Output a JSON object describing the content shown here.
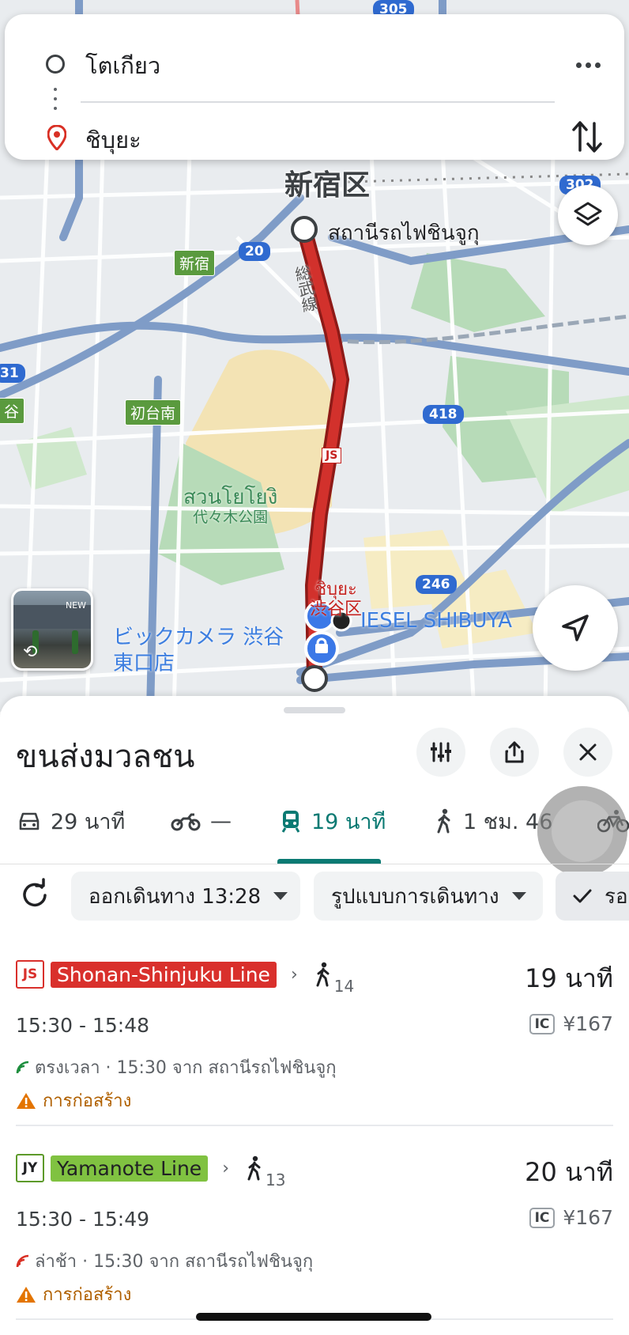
{
  "search": {
    "origin": "โตเกียว",
    "destination": "ชิบุยะ"
  },
  "map": {
    "labels": {
      "shinjuku_ward": "新宿区",
      "station_shinjuku": "สถานีรถไฟชินจูกุ",
      "shinjuku_badge": "新宿",
      "hatsudaiminami_badge": "初台南",
      "ward_edge_badge": "谷",
      "route_20": "20",
      "route_302": "302",
      "route_305": "305",
      "route_418": "418",
      "route_246": "246",
      "route_31": "31",
      "line_sobu": "総武線",
      "line_js": "JS",
      "park_thai": "สวนโยโยงิ",
      "park_jp": "代々木公園",
      "shibuya_thai": "ชิบุยะ",
      "shibuya_ward": "渋谷区",
      "poi_bic_1": "ビックカメラ 渋谷",
      "poi_bic_2": "東口店",
      "poi_diesel": "IESEL SHIBUYA",
      "thumb_sign": "NEW"
    }
  },
  "sheet": {
    "title": "ขนส่งมวลชน",
    "tabs": [
      {
        "icon": "car-icon",
        "label": "29 นาที"
      },
      {
        "icon": "motorbike-icon",
        "label": "—"
      },
      {
        "icon": "train-icon",
        "label": "19 นาที",
        "active": true
      },
      {
        "icon": "walk-icon",
        "label": "1 ชม. 46"
      },
      {
        "icon": "bike-icon",
        "label": ""
      }
    ],
    "filters": {
      "depart": "ออกเดินทาง 13:28",
      "route_options": "รูปแบบการเดินทาง",
      "accessible": "รอ"
    },
    "routes": [
      {
        "line_code": "JS",
        "line_name": "Shonan-Shinjuku Line",
        "line_color": "#d9302c",
        "walk_minutes": "14",
        "duration": "19 นาที",
        "times": "15:30 - 15:48",
        "fare_badge": "IC",
        "fare": "¥167",
        "realtime": "ตรงเวลา · 15:30 จาก สถานีรถไฟชินจูกุ",
        "realtime_color": "#1e8e3e",
        "warning": "การก่อสร้าง"
      },
      {
        "line_code": "JY",
        "line_name": "Yamanote Line",
        "line_color": "#80c241",
        "walk_minutes": "13",
        "duration": "20 นาที",
        "times": "15:30 - 15:49",
        "fare_badge": "IC",
        "fare": "¥167",
        "realtime": "ล่าช้า · 15:30 จาก สถานีรถไฟชินจูกุ",
        "realtime_color": "#d93025",
        "warning": "การก่อสร้าง"
      }
    ]
  },
  "colors": {
    "accent": "#0b7a73",
    "route_line": "#c5221f",
    "warning": "#b06000"
  }
}
